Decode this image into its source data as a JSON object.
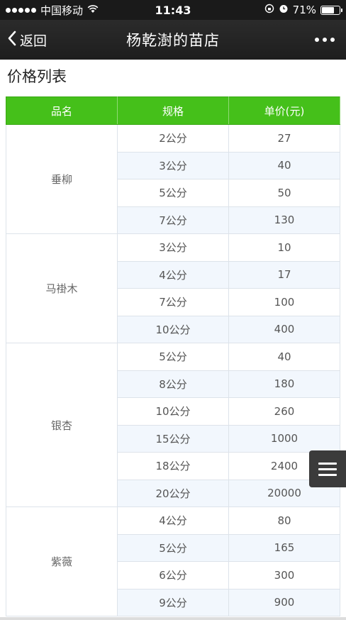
{
  "status": {
    "carrier": "中国移动",
    "time": "11:43",
    "battery": "71%",
    "battery_level": 0.71
  },
  "nav": {
    "back_label": "返回",
    "title": "杨乾澍的苗店"
  },
  "section_title": "价格列表",
  "table": {
    "headers": [
      "品名",
      "规格",
      "单价(元)"
    ],
    "groups": [
      {
        "name": "垂柳",
        "rows": [
          [
            "2公分",
            "27"
          ],
          [
            "3公分",
            "40"
          ],
          [
            "5公分",
            "50"
          ],
          [
            "7公分",
            "130"
          ]
        ]
      },
      {
        "name": "马褂木",
        "rows": [
          [
            "3公分",
            "10"
          ],
          [
            "4公分",
            "17"
          ],
          [
            "7公分",
            "100"
          ],
          [
            "10公分",
            "400"
          ]
        ]
      },
      {
        "name": "银杏",
        "rows": [
          [
            "5公分",
            "40"
          ],
          [
            "8公分",
            "180"
          ],
          [
            "10公分",
            "260"
          ],
          [
            "15公分",
            "1000"
          ],
          [
            "18公分",
            "2400"
          ],
          [
            "20公分",
            "20000"
          ]
        ]
      },
      {
        "name": "紫薇",
        "rows": [
          [
            "4公分",
            "80"
          ],
          [
            "5公分",
            "165"
          ],
          [
            "6公分",
            "300"
          ],
          [
            "9公分",
            "900"
          ]
        ]
      }
    ]
  },
  "colors": {
    "header_green": "#45c01a",
    "navbar": "#222222"
  },
  "icons": [
    "signal-dots-icon",
    "wifi-icon",
    "lock-rotation-icon",
    "alarm-icon",
    "battery-icon",
    "back-chevron-icon",
    "more-dots-icon",
    "menu-icon"
  ]
}
